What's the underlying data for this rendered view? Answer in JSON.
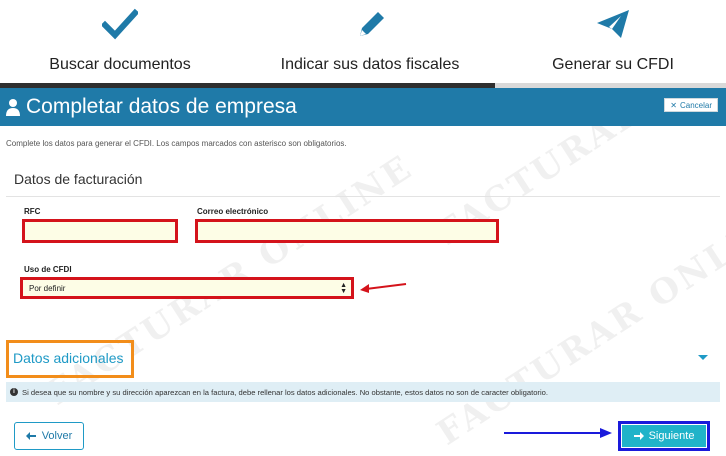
{
  "steps": [
    {
      "label": "Buscar documentos",
      "icon": "check-icon",
      "state": "done"
    },
    {
      "label": "Indicar sus datos fiscales",
      "icon": "pencil-icon",
      "state": "current"
    },
    {
      "label": "Generar su CFDI",
      "icon": "paper-plane-icon",
      "state": "pending"
    }
  ],
  "header": {
    "title": "Completar datos de empresa",
    "cancel_label": "Cancelar"
  },
  "intro": "Complete los datos para generar el CFDI. Los campos marcados con asterisco son obligatorios.",
  "billing": {
    "title": "Datos de facturación",
    "rfc_label": "RFC",
    "rfc_value": "",
    "email_label": "Correo electrónico",
    "email_value": "",
    "cfdi_label": "Uso de CFDI",
    "cfdi_selected": "Por definir"
  },
  "additional": {
    "title": "Datos adicionales",
    "info": "Si desea que su nombre y su dirección aparezcan en la factura, debe rellenar los datos adicionales. No obstante, estos datos no son de caracter obligatorio."
  },
  "actions": {
    "back_label": "Volver",
    "next_label": "Siguiente"
  },
  "watermark_text": "FACTURAR ONLINE",
  "colors": {
    "primary": "#1f7aa8",
    "accent": "#20b3c9",
    "highlight_red": "#d4131b",
    "highlight_orange": "#f28d1a",
    "highlight_blue": "#1a1adb",
    "input_bg": "#fdfde6"
  }
}
